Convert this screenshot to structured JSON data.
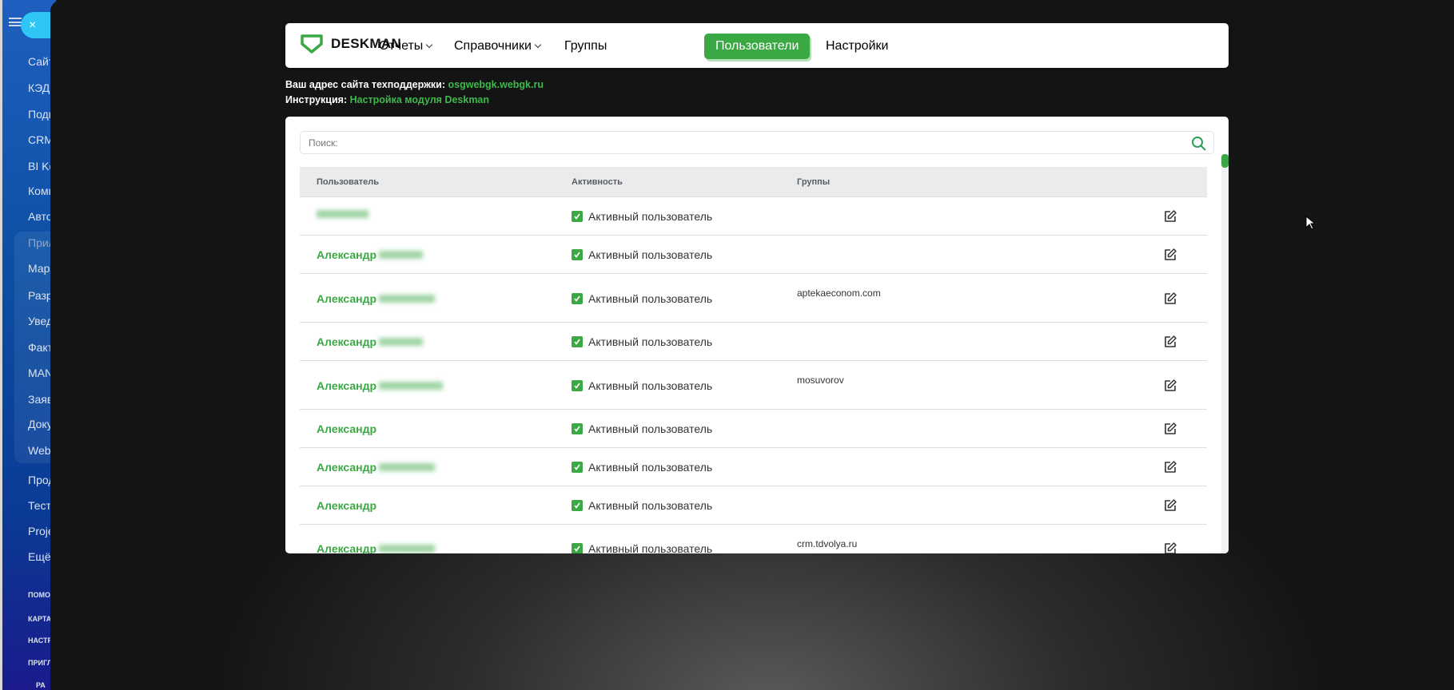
{
  "sidebar": {
    "close_label": "×",
    "items": [
      "Сайт",
      "КЭДО",
      "Подп",
      "CRM",
      "BI Ko",
      "Комп",
      "Авто",
      "Прил",
      "Марк",
      "Разр",
      "Увед",
      "Факт",
      "MAN",
      "Заяв",
      "Доку",
      "Web",
      "Прод",
      "Тест",
      "Proje",
      "Ещё"
    ],
    "small_items": [
      "ПОМО",
      "КАРТА",
      "НАСТР",
      "ПРИГЛ"
    ],
    "bottom": "РА"
  },
  "header": {
    "logo": "DESKMAN",
    "nav": [
      {
        "label": "Отчеты",
        "dropdown": true
      },
      {
        "label": "Справочники",
        "dropdown": true
      },
      {
        "label": "Группы"
      },
      {
        "label": "Пользователи",
        "active": true
      },
      {
        "label": "Настройки"
      }
    ]
  },
  "info": {
    "support_label": "Ваш адрес сайта техподдержки:",
    "support_link": "osgwebgk.webgk.ru",
    "instr_label": "Инструкция:",
    "instr_link": "Настройка модуля Deskman"
  },
  "search": {
    "placeholder": "Поиск:"
  },
  "table": {
    "columns": [
      "Пользователь",
      "Активность",
      "Группы"
    ],
    "rows": [
      {
        "name": "",
        "activity": "Активный пользователь",
        "group": ""
      },
      {
        "name": "Александр",
        "activity": "Активный пользователь",
        "group": ""
      },
      {
        "name": "Александр",
        "activity": "Активный пользователь",
        "group": "aptekaeconom.com"
      },
      {
        "name": "Александр",
        "activity": "Активный пользователь",
        "group": ""
      },
      {
        "name": "Александр",
        "activity": "Активный пользователь",
        "group": "mosuvorov"
      },
      {
        "name": "Александр",
        "activity": "Активный пользователь",
        "group": ""
      },
      {
        "name": "Александр",
        "activity": "Активный пользователь",
        "group": ""
      },
      {
        "name": "Александр",
        "activity": "Активный пользователь",
        "group": ""
      },
      {
        "name": "Александр",
        "activity": "Активный пользователь",
        "group": "crm.tdvolya.ru"
      }
    ]
  },
  "colors": {
    "accent": "#3aa843"
  }
}
